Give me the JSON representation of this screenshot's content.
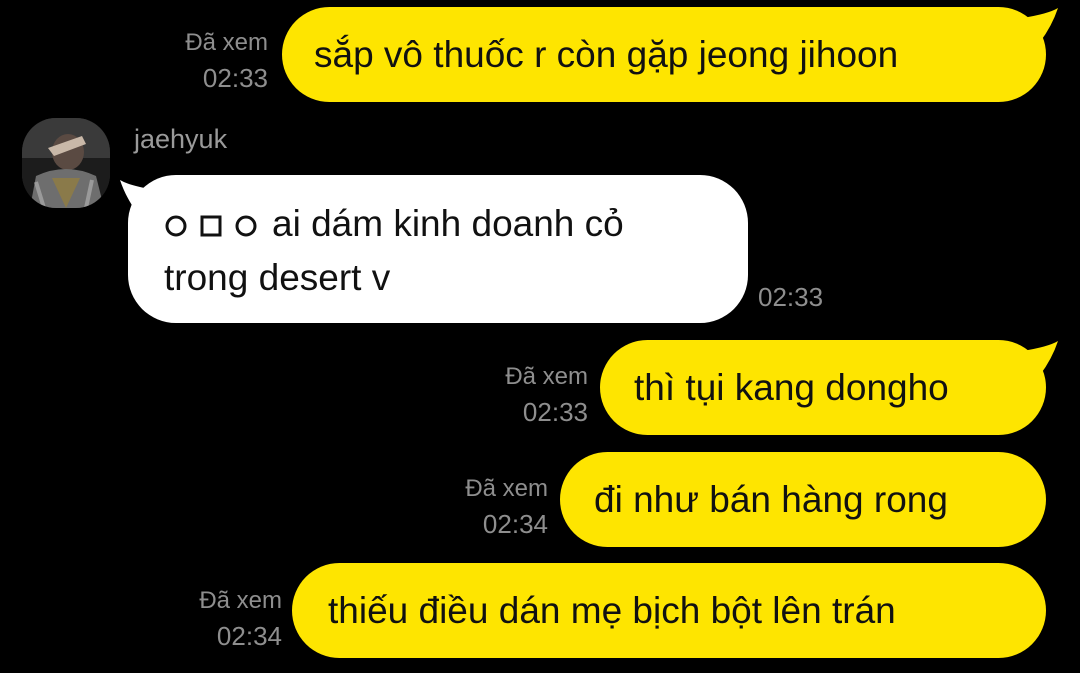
{
  "colors": {
    "background": "#000000",
    "outgoing_bubble": "#FEE500",
    "incoming_bubble": "#FFFFFF",
    "meta_text": "#8E8E8E"
  },
  "messages": [
    {
      "direction": "outgoing",
      "read_label": "Đã xem",
      "time": "02:33",
      "text": "sắp vô thuốc r còn gặp jeong jihoon"
    },
    {
      "direction": "incoming",
      "sender": "jaehyuk",
      "avatar": "profile-photo",
      "shape_icons": [
        "circle-icon",
        "square-icon",
        "circle-icon"
      ],
      "lines": [
        "ai dám kinh doanh cỏ",
        "trong desert v"
      ],
      "time": "02:33"
    },
    {
      "direction": "outgoing",
      "read_label": "Đã xem",
      "time": "02:33",
      "text": "thì tụi kang dongho"
    },
    {
      "direction": "outgoing",
      "read_label": "Đã xem",
      "time": "02:34",
      "text": "đi như bán hàng rong"
    },
    {
      "direction": "outgoing",
      "read_label": "Đã xem",
      "time": "02:34",
      "text": "thiếu điều dán mẹ bịch bột lên trán"
    }
  ]
}
